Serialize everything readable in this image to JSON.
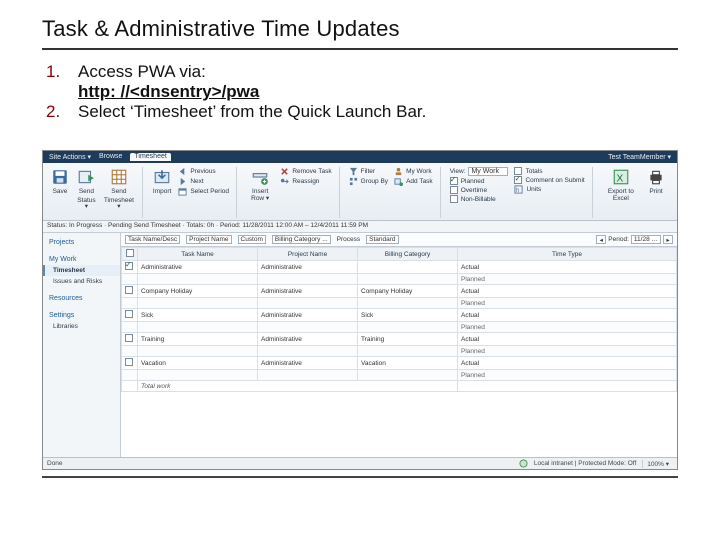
{
  "slide": {
    "title": "Task & Administrative Time Updates",
    "steps": {
      "s1_num": "1.",
      "s1_text": "Access PWA via:",
      "url": "http: //<dnsentry>/pwa",
      "s2_num": "2.",
      "s2_text": "Select ‘Timesheet’ from the Quick Launch Bar."
    }
  },
  "topbar": {
    "site_actions": "Site Actions ▾",
    "browse": "Browse",
    "timesheet": "Timesheet",
    "user": "Test TeamMember ▾"
  },
  "ribbon": {
    "save": "Save",
    "send_status_line1": "Send",
    "send_status_line2": "Status ▾",
    "send_timesheet_line1": "Send",
    "send_timesheet_line2": "Timesheet ▾",
    "import": "Import",
    "previous": "Previous",
    "next": "Next",
    "select_period": "Select Period",
    "insert_row": "Insert Row ▾",
    "remove_task": "Remove Task",
    "reassign": "Reassign",
    "filter": "Filter",
    "group_by": "Group By",
    "my_work": "My Work",
    "add_task": "Add Task",
    "view": "View:",
    "view_value": "My Work",
    "overtime": "Overtime",
    "non_billable": "Non-Billable",
    "planned": "Planned",
    "comment_on_submit": "Comment on Submit",
    "totals": "Totals",
    "units": "Units",
    "export": "Export to Excel",
    "print": "Print"
  },
  "status": {
    "text": "Status: In Progress · Pending Send Timesheet · Totals: 0h · Period: 11/28/2011 12:00 AM – 12/4/2011 11:59 PM"
  },
  "sidebar": {
    "projects": "Projects",
    "my_work": "My Work",
    "timesheet": "Timesheet",
    "issues_risks": "Issues and Risks",
    "resources": "Resources",
    "settings": "Settings",
    "libraries": "Libraries"
  },
  "filter": {
    "cat_label": "Task Name/Desc",
    "cat_value": "Project Name",
    "cat2_label": "Custom",
    "bill_label": "Billing Category ...",
    "process": "Process",
    "process_value": "Standard",
    "period_label": "Period:",
    "period_value": "11/28 …"
  },
  "grid": {
    "columns": {
      "chk": "",
      "task": "Task Name",
      "project": "Project Name",
      "billing": "Billing Category",
      "time": "Time Type"
    },
    "rows": [
      {
        "chk": true,
        "task": "Administrative",
        "project": "Administrative",
        "billing": "",
        "sub1": "Actual",
        "sub2": "Planned"
      },
      {
        "chk": false,
        "task": "Company Holiday",
        "project": "Administrative",
        "billing": "Company Holiday",
        "sub1": "Actual",
        "sub2": "Planned"
      },
      {
        "chk": false,
        "task": "Sick",
        "project": "Administrative",
        "billing": "Sick",
        "sub1": "Actual",
        "sub2": "Planned"
      },
      {
        "chk": false,
        "task": "Training",
        "project": "Administrative",
        "billing": "Training",
        "sub1": "Actual",
        "sub2": "Planned"
      },
      {
        "chk": false,
        "task": "Vacation",
        "project": "Administrative",
        "billing": "Vacation",
        "sub1": "Actual",
        "sub2": "Planned"
      }
    ],
    "total_label": "Total work"
  },
  "iestatus": {
    "done": "Done",
    "zone": "Local intranet | Protected Mode: Off",
    "zoom": "100% ▾"
  }
}
